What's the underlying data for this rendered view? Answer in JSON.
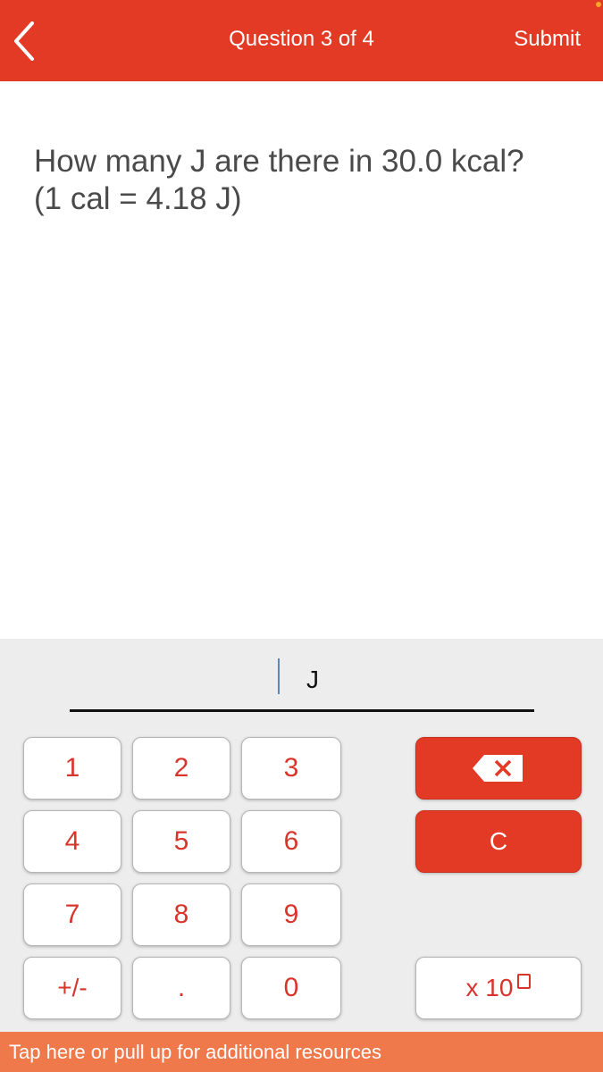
{
  "header": {
    "title": "Question 3 of 4",
    "submit_label": "Submit",
    "back_icon": "chevron-left-icon"
  },
  "question": {
    "line1": "How many J are there in 30.0 kcal?",
    "line2": "(1 cal = 4.18 J)"
  },
  "answer": {
    "value": "",
    "unit": "J"
  },
  "keypad": {
    "k1": "1",
    "k2": "2",
    "k3": "3",
    "k4": "4",
    "k5": "5",
    "k6": "6",
    "k7": "7",
    "k8": "8",
    "k9": "9",
    "sign": "+/-",
    "dot": ".",
    "k0": "0",
    "backspace_icon": "backspace-icon",
    "clear": "C",
    "exponent": "x 10"
  },
  "footer": {
    "resources": "Tap here or pull up for additional resources"
  },
  "colors": {
    "header": "#e23a25",
    "accent_text": "#d9342b",
    "footer": "#ef794a",
    "keypad_bg": "#ededed"
  }
}
